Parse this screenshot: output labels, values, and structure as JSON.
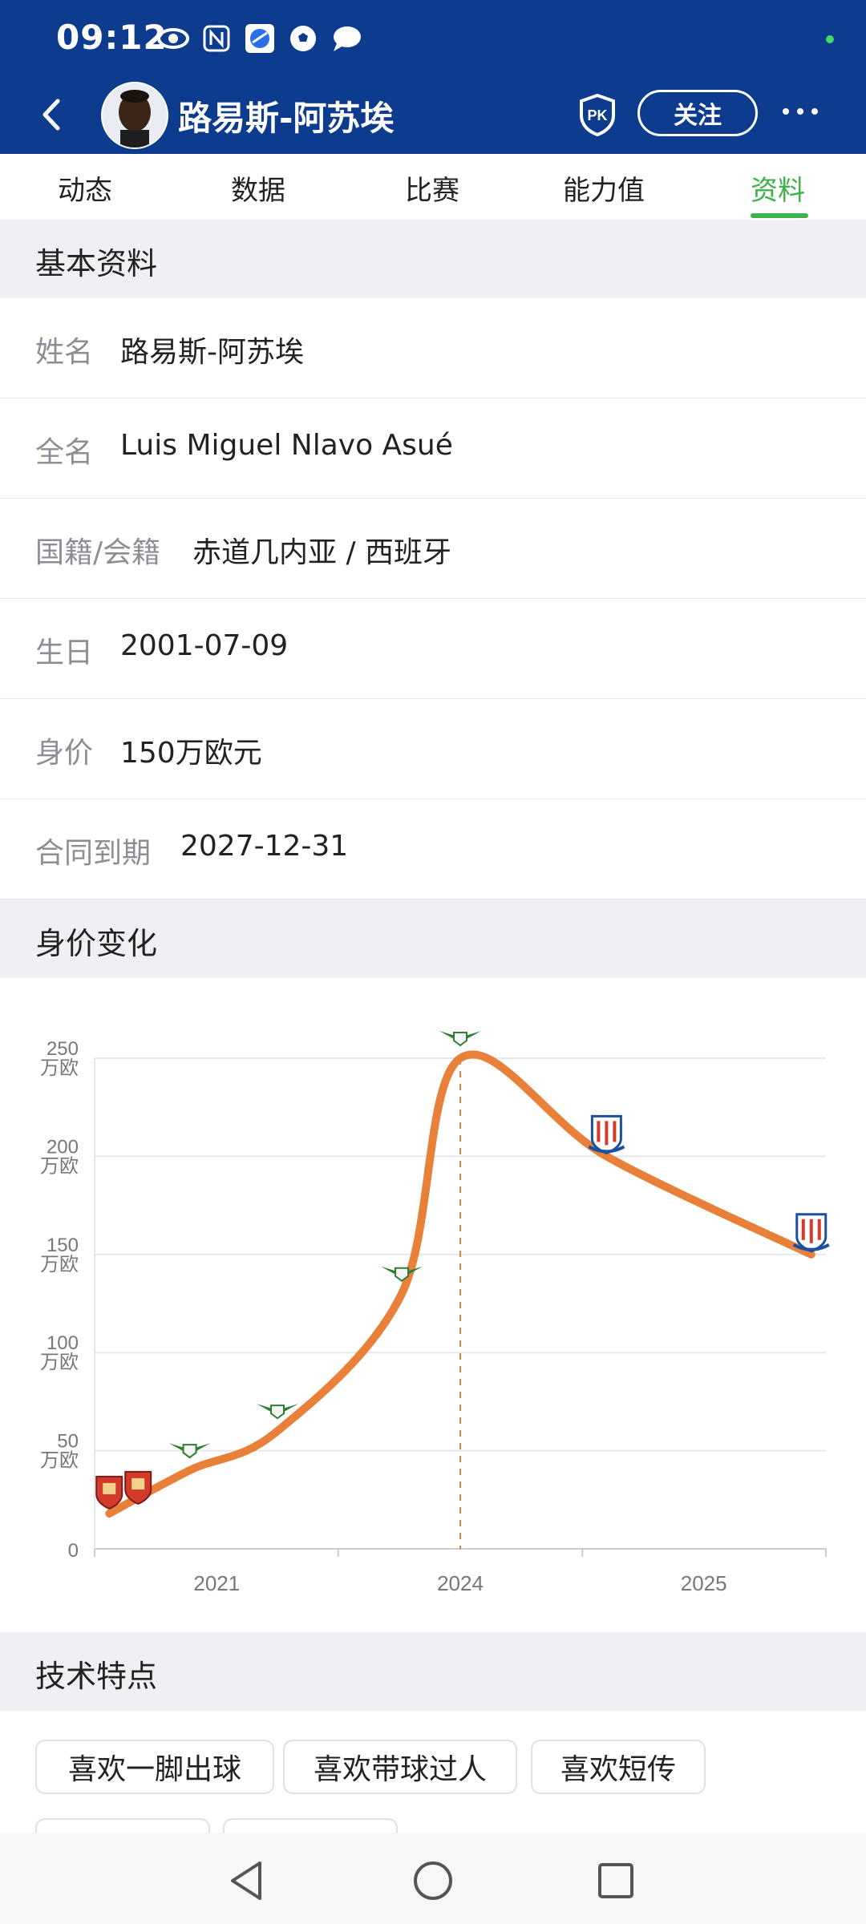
{
  "status": {
    "time": "09:12",
    "icons": [
      "eye-icon",
      "nfc-icon",
      "app-icon",
      "soccer-icon",
      "chat-icon"
    ]
  },
  "header": {
    "player_name": "路易斯-阿苏埃",
    "follow_label": "关注",
    "pk_label": "PK"
  },
  "tabs": [
    {
      "label": "动态"
    },
    {
      "label": "数据"
    },
    {
      "label": "比赛"
    },
    {
      "label": "能力值"
    },
    {
      "label": "资料",
      "active": true
    }
  ],
  "basic_info": {
    "section_title": "基本资料",
    "rows": [
      {
        "label": "姓名",
        "value": "路易斯-阿苏埃"
      },
      {
        "label": "全名",
        "value": "Luis Miguel Nlavo Asué"
      },
      {
        "label": "国籍/会籍",
        "value": "赤道几内亚 / 西班牙"
      },
      {
        "label": "生日",
        "value": "2001-07-09"
      },
      {
        "label": "身价",
        "value": "150万欧元"
      },
      {
        "label": "合同到期",
        "value": "2027-12-31"
      }
    ]
  },
  "value_section": {
    "section_title": "身价变化"
  },
  "chart_data": {
    "type": "line",
    "y_ticks": [
      {
        "value": 250,
        "label": "250\n万欧"
      },
      {
        "value": 200,
        "label": "200\n万欧"
      },
      {
        "value": 150,
        "label": "150\n万欧"
      },
      {
        "value": 100,
        "label": "100\n万欧"
      },
      {
        "value": 50,
        "label": "50\n万欧"
      },
      {
        "value": 0,
        "label": "0"
      }
    ],
    "x_ticks": [
      "2021",
      "2024",
      "2025"
    ],
    "ylim": [
      0,
      250
    ],
    "points": [
      {
        "t": 0.02,
        "value": 18,
        "club": "braga"
      },
      {
        "t": 0.13,
        "value": 40,
        "club": "moreirense"
      },
      {
        "t": 0.25,
        "value": 60,
        "club": "moreirense"
      },
      {
        "t": 0.42,
        "value": 130,
        "club": "moreirense"
      },
      {
        "t": 0.5,
        "value": 250,
        "club": "moreirense"
      },
      {
        "t": 0.7,
        "value": 200,
        "club": "shanghai-shenhua"
      },
      {
        "t": 0.98,
        "value": 150,
        "club": "shanghai-shenhua"
      }
    ],
    "line_color": "#e8803a",
    "peak_marker_t": 0.5,
    "grid": true
  },
  "skills": {
    "section_title": "技术特点",
    "tags": [
      "喜欢一脚出球",
      "喜欢带球过人",
      "喜欢短传"
    ]
  },
  "colors": {
    "brand": "#0d3b8e",
    "accent": "#3cb24a",
    "line": "#e8803a"
  }
}
